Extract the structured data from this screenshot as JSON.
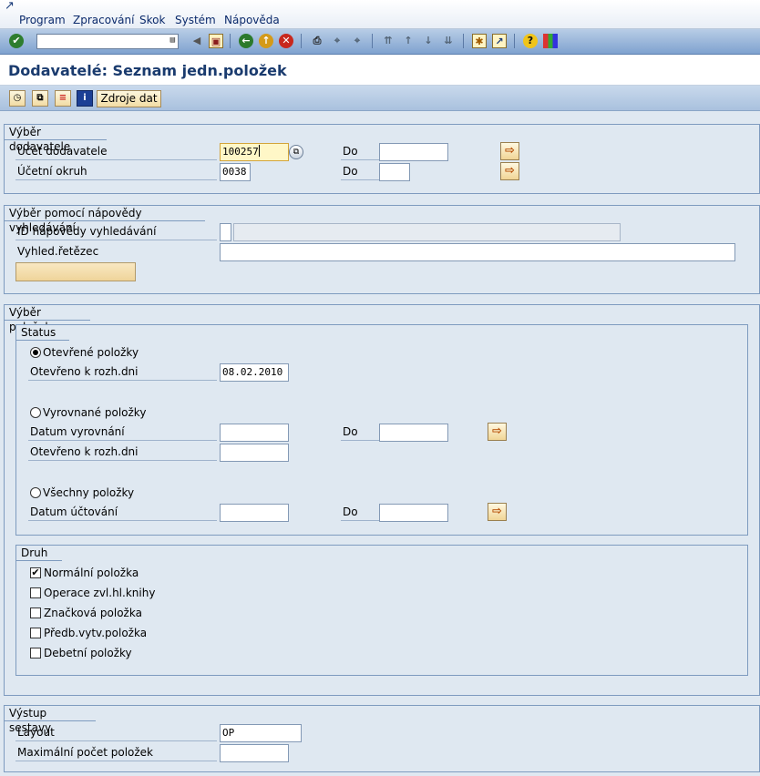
{
  "menu": [
    "Program",
    "Zpracování",
    "Skok",
    "Systém",
    "Nápověda"
  ],
  "toolbar": {
    "command_value": "",
    "icons": [
      "enter-icon",
      "back-icon",
      "save-icon",
      "back-nav-icon",
      "exit-icon",
      "cancel-icon",
      "print-icon",
      "find-icon",
      "find-next-icon",
      "first-page-icon",
      "prev-page-icon",
      "next-page-icon",
      "last-page-icon",
      "new-session-icon",
      "shortcut-icon",
      "help-icon",
      "layout-icon"
    ]
  },
  "title": "Dodavatelé: Seznam jedn.položek",
  "app_toolbar": {
    "data_source_label": "Zdroje dat"
  },
  "vendor_selection": {
    "title": "Výběr dodavatele",
    "account_label": "Účet dodavatele",
    "account_value": "100257",
    "to_label": "Do",
    "company_code_label": "Účetní okruh",
    "company_code_value": "0038",
    "to_label_2": "Do"
  },
  "search_help": {
    "title": "Výběr pomocí nápovědy vyhledávání",
    "id_label": "ID nápovědy vyhledávání",
    "string_label": "Vyhled.řetězec"
  },
  "item_selection": {
    "title": "Výběr položek",
    "status_title": "Status",
    "open_items_label": "Otevřené položky",
    "open_at_key_date_label": "Otevřeno k rozh.dni",
    "open_at_key_date_value": "08.02.2010",
    "cleared_items_label": "Vyrovnané položky",
    "clearing_date_label": "Datum vyrovnání",
    "to_label": "Do",
    "open_at_key_date_label_2": "Otevřeno k rozh.dni",
    "all_items_label": "Všechny položky",
    "posting_date_label": "Datum účtování",
    "to_label_2": "Do",
    "type_title": "Druh",
    "types": [
      {
        "label": "Normální položka",
        "checked": true
      },
      {
        "label": "Operace zvl.hl.knihy",
        "checked": false
      },
      {
        "label": "Značková položka",
        "checked": false
      },
      {
        "label": "Předb.vytv.položka",
        "checked": false
      },
      {
        "label": "Debetní položky",
        "checked": false
      }
    ]
  },
  "output": {
    "title": "Výstup sestavy",
    "layout_label": "Layout",
    "layout_value": "OP",
    "max_items_label": "Maximální počet položek",
    "max_items_value": ""
  }
}
